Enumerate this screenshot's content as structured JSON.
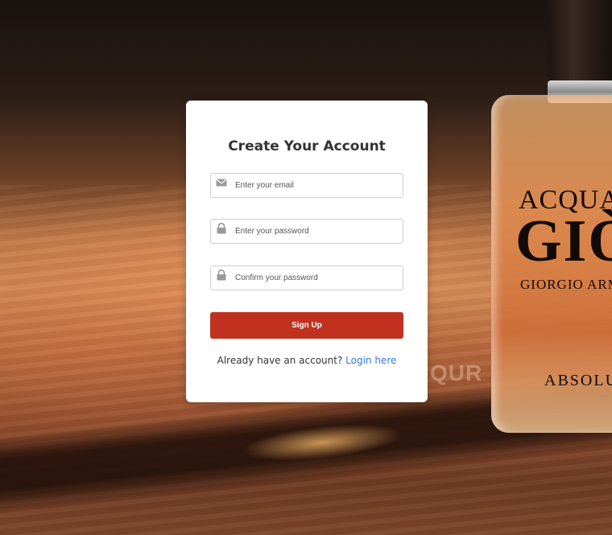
{
  "background": {
    "bottle_label_lines": [
      "ACQUA DI",
      "GIÒ",
      "GIORGIO ARMANI",
      "ABSOLU"
    ],
    "ghost_text": "QUR"
  },
  "signup": {
    "title": "Create Your Account",
    "email": {
      "placeholder": "Enter your email",
      "value": "",
      "icon": "envelope-icon"
    },
    "password": {
      "placeholder": "Enter your password",
      "value": "",
      "icon": "lock-icon"
    },
    "confirm_password": {
      "placeholder": "Confirm your password",
      "value": "",
      "icon": "lock-icon"
    },
    "submit_label": "Sign Up",
    "login_prompt": "Already have an account? ",
    "login_link": "Login here"
  },
  "colors": {
    "primary_button": "#c0311f",
    "link": "#2f7ae5",
    "card_bg": "#ffffff"
  }
}
